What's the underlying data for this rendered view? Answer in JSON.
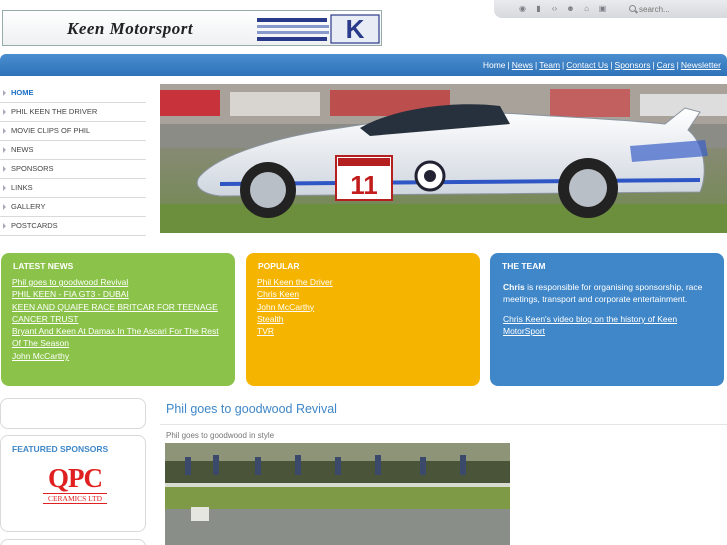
{
  "site": {
    "logo_text": "Keen Motorsport",
    "logo_letter": "K"
  },
  "search": {
    "placeholder": "search..."
  },
  "util_icons": [
    "rss-icon",
    "toolbar-icon",
    "code-icon",
    "user-icon",
    "home-icon",
    "print-icon"
  ],
  "nav": {
    "items": [
      "Home",
      "News",
      "Team",
      "Contact Us",
      "Sponsors",
      "Cars",
      "Newsletter"
    ]
  },
  "sidebar": {
    "items": [
      {
        "label": "HOME",
        "active": true
      },
      {
        "label": "PHIL KEEN THE DRIVER"
      },
      {
        "label": "MOVIE CLIPS OF PHIL"
      },
      {
        "label": "NEWS"
      },
      {
        "label": "SPONSORS"
      },
      {
        "label": "LINKS"
      },
      {
        "label": "GALLERY"
      },
      {
        "label": "POSTCARDS"
      }
    ]
  },
  "hero": {
    "car_number": "11"
  },
  "latest_news": {
    "title": "LATEST NEWS",
    "items": [
      "Phil goes to goodwood Revival",
      "PHIL KEEN - FIA GT3 - DUBAI",
      "KEEN AND QUAIFE RACE BRITCAR FOR TEENAGE CANCER TRUST",
      "Bryant And Keen At Damax In The Ascari For The Rest Of The Season",
      "John McCarthy"
    ]
  },
  "popular": {
    "title": "POPULAR",
    "items": [
      "Phil Keen the Driver",
      "Chris Keen",
      "John McCarthy",
      "Stealth",
      "TVR"
    ]
  },
  "team": {
    "title": "THE TEAM",
    "name": "Chris",
    "text": " is responsible for organising sponsorship, race meetings, transport and corporate entertainment.",
    "link": "Chris Keen's video blog on the history of Keen MotorSport"
  },
  "featured_sponsors": {
    "title": "FEATURED SPONSORS",
    "logo_main": "QPC",
    "logo_sub": "CERAMICS LTD"
  },
  "article": {
    "title": "Phil goes to goodwood Revival",
    "caption": "Phil goes to goodwood in style"
  },
  "colors": {
    "nav_blue": "#3f87c8",
    "green": "#8bc34a",
    "orange": "#f5b400",
    "qpc_red": "#e02020"
  }
}
